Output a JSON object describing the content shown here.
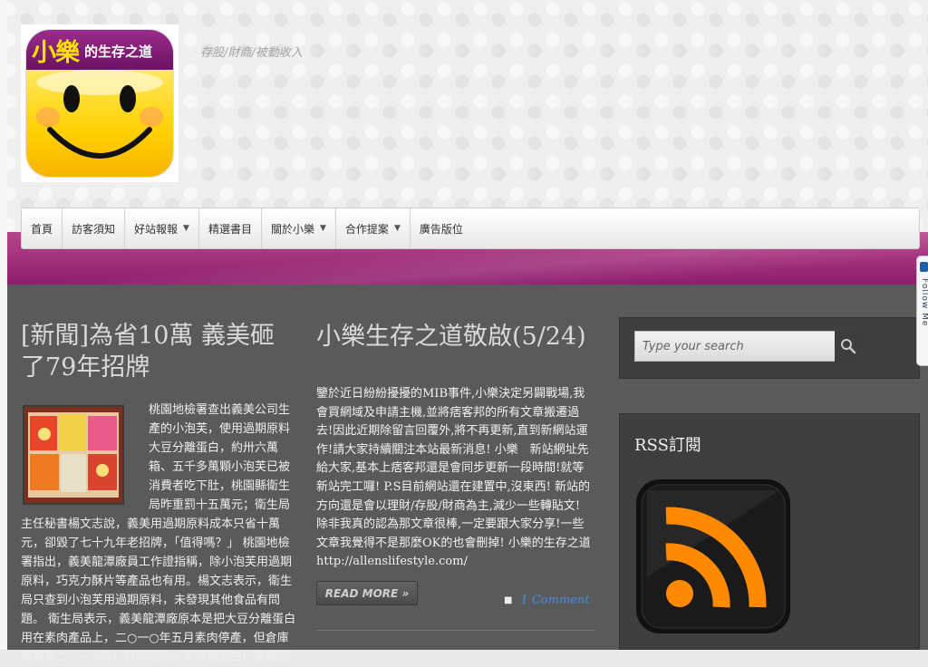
{
  "header": {
    "logo": {
      "big_text": "小樂",
      "small_text": "的生存之道"
    },
    "tagline": "存股/財商/被動收入"
  },
  "nav": {
    "items": [
      {
        "label": "首頁",
        "has_dropdown": false
      },
      {
        "label": "訪客須知",
        "has_dropdown": false
      },
      {
        "label": "好站報報",
        "has_dropdown": true
      },
      {
        "label": "精選書目",
        "has_dropdown": false
      },
      {
        "label": "關於小樂",
        "has_dropdown": true
      },
      {
        "label": "合作提案",
        "has_dropdown": true
      },
      {
        "label": "廣告版位",
        "has_dropdown": false
      }
    ]
  },
  "posts": [
    {
      "title": "[新聞]為省10萬 義美砸了79年招牌",
      "excerpt": "桃園地檢署查出義美公司生產的小泡芙，使用過期原料大豆分離蛋白，約卅六萬箱、五千多萬顆小泡芙已被消費者吃下肚，桃園縣衛生局昨重罰十五萬元；衛生局主任秘書楊文志說，義美用過期原料成本只省十萬元，卻毀了七十九年老招牌，「值得嗎？」 桃園地檢署指出，義美龍潭廠員工作證指稱，除小泡芙用過期原料，巧克力酥片等產品也有用。楊文志表示，衛生局只查到小泡芙用過期原料，未發現其他食品有問題。 衛生局表示，義美龍潭廠原本是把大豆分離蛋白用在素肉產品上，二○一○年五月素肉停產，但倉庫裡還有二○一○年八月到期的大豆分離蛋白，業者因"
    },
    {
      "title": "小樂生存之道敬啟(5/24)",
      "excerpt": "鑒於近日紛紛擾擾的MIB事件,小樂決定另闢戰場,我會買網域及申請主機,並將痞客邦的所有文章搬遷過去!因此近期除留言回覆外,將不再更新,直到新網站運作!請大家持續關注本站最新消息! 小樂　新站網址先給大家,基本上痞客邦還是會同步更新一段時間!就等新站完工囉! P.S目前網站還在建置中,沒東西! 新站的方向還是會以理財/存股/財商為主,減少一些轉貼文! 除非我真的認為那文章很棒,一定要跟大家分享!一些文章我覺得不是那麼OK的也會刪掉! 小樂的生存之道",
      "link_text": "http://allenslifestyle.com/",
      "read_more": "READ MORE »",
      "comments": "1 Comment"
    }
  ],
  "sidebar": {
    "search": {
      "placeholder": "Type your search"
    },
    "rss": {
      "title": "RSS訂閱"
    }
  },
  "follow_tab": {
    "label": "Follow Me"
  },
  "colors": {
    "accent_pink": "#a5317f",
    "content_bg": "#5a5a5a",
    "link_blue": "#3f8fe8",
    "rss_orange": "#ff8a00"
  }
}
